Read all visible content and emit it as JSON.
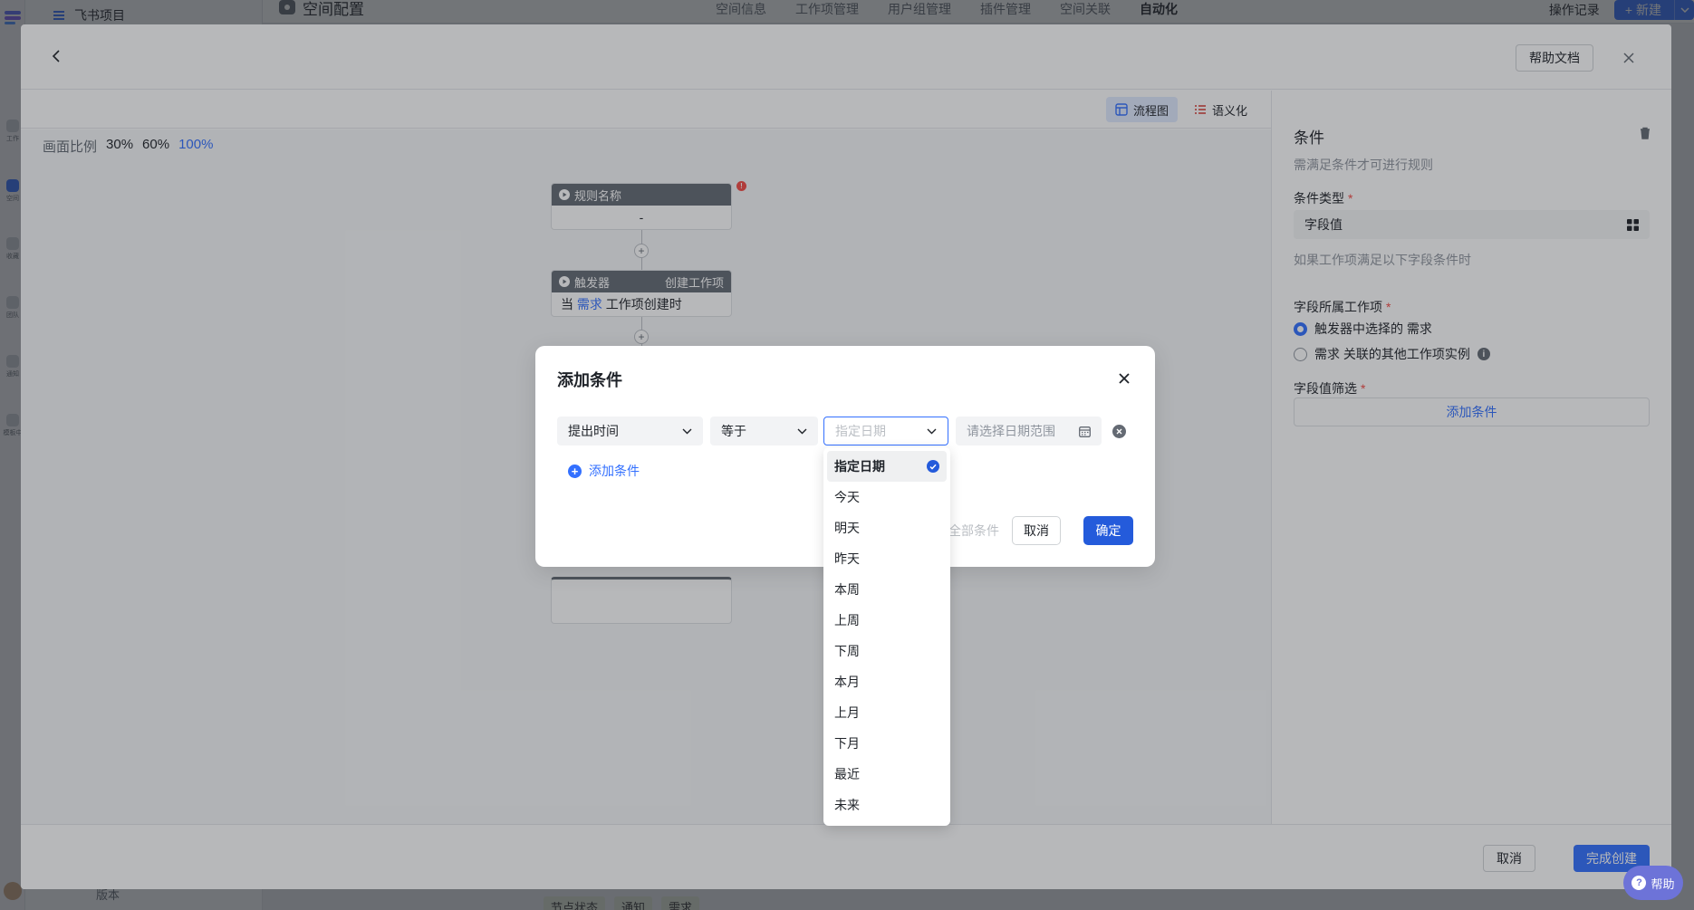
{
  "app": {
    "project_name": "飞书项目",
    "page_title": "空间配置",
    "tabs": [
      {
        "label": "空间信息",
        "active": false
      },
      {
        "label": "工作项管理",
        "active": false
      },
      {
        "label": "用户组管理",
        "active": false
      },
      {
        "label": "插件管理",
        "active": false
      },
      {
        "label": "空间关联",
        "active": false
      },
      {
        "label": "自动化",
        "active": true
      }
    ],
    "op_log": "操作记录",
    "new_label": "新建",
    "rail": [
      "工作",
      "空间",
      "收藏",
      "团队",
      "通知",
      "模板中"
    ],
    "bottom_chips": [
      "节点状态",
      "通知",
      "需求"
    ],
    "version_label": "版本"
  },
  "panel": {
    "help_doc": "帮助文档",
    "view_flow": "流程图",
    "view_semantic": "语义化",
    "zoom_label": "画面比例",
    "zoom_options": [
      "30%",
      "60%",
      "100%"
    ],
    "zoom_active": "100%",
    "nodes": {
      "rule_title": "规则名称",
      "rule_value": "-",
      "trigger_title": "触发器",
      "trigger_type": "创建工作项",
      "trigger_prefix": "当",
      "trigger_item": "需求",
      "trigger_suffix": "工作项创建时"
    },
    "side": {
      "title": "条件",
      "subtitle": "需满足条件才可进行规则",
      "cond_type_label": "条件类型",
      "cond_type_value": "字段值",
      "cond_type_hint": "如果工作项满足以下字段条件时",
      "belong_label": "字段所属工作项",
      "radio_1": "触发器中选择的 需求",
      "radio_2": "需求 关联的其他工作项实例",
      "filter_label": "字段值筛选",
      "add_condition": "添加条件"
    },
    "footer": {
      "cancel": "取消",
      "done": "完成创建"
    },
    "help": "帮助"
  },
  "modal": {
    "title": "添加条件",
    "field": "提出时间",
    "operator": "等于",
    "date_mode_placeholder": "指定日期",
    "date_range_placeholder": "请选择日期范围",
    "add_condition": "添加条件",
    "clear_all": "全部条件",
    "cancel": "取消",
    "confirm": "确定"
  },
  "dropdown": {
    "selected": "指定日期",
    "options": [
      "指定日期",
      "今天",
      "明天",
      "昨天",
      "本周",
      "上周",
      "下周",
      "本月",
      "上月",
      "下月",
      "最近",
      "未来"
    ]
  },
  "colors": {
    "accent": "#3370ff",
    "primary_btn": "#245bdb",
    "danger": "#f54a45"
  }
}
